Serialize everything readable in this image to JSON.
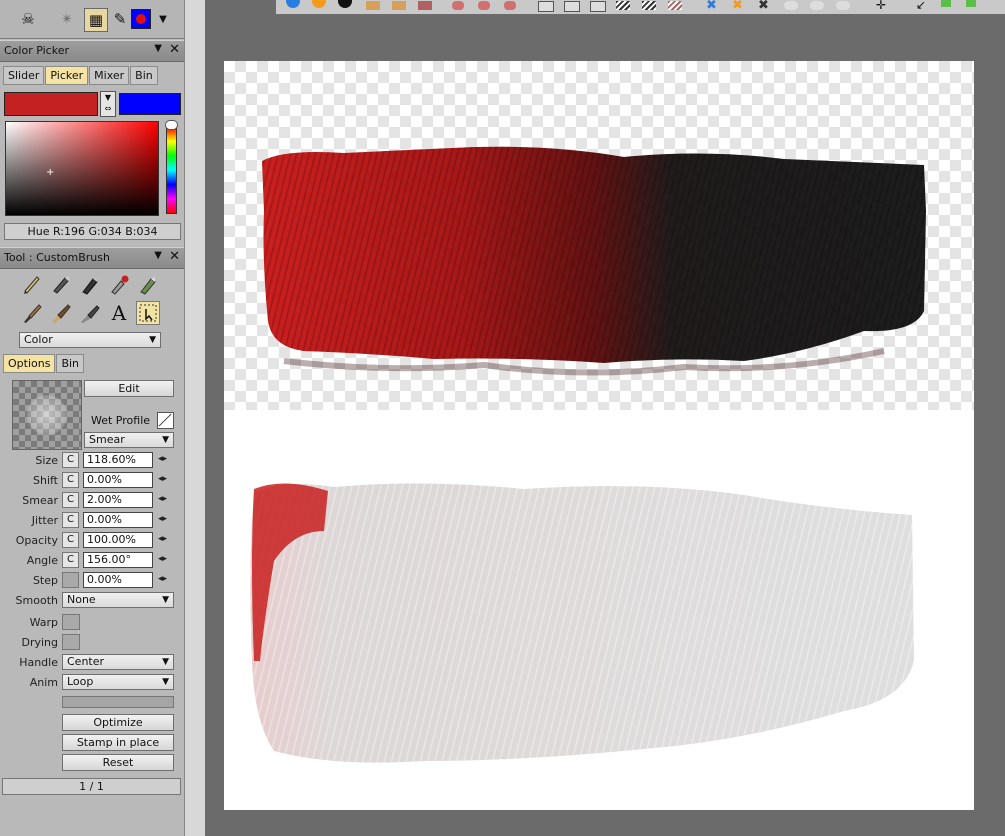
{
  "color_picker": {
    "title": "Color Picker",
    "tabs": [
      "Slider",
      "Picker",
      "Mixer",
      "Bin"
    ],
    "active_tab": "Picker",
    "primary_color": "#c42222",
    "secondary_color": "#0000ff",
    "readout": "Hue R:196 G:034 B:034"
  },
  "tool": {
    "title": "Tool : CustomBrush",
    "mode_select": "Color",
    "tabs": [
      "Options",
      "Bin"
    ],
    "active_tab": "Options",
    "edit_label": "Edit",
    "wet_profile_label": "Wet Profile",
    "brush_mode": "Smear",
    "params": [
      {
        "label": "Size",
        "value": "118.60%"
      },
      {
        "label": "Shift",
        "value": "0.00%"
      },
      {
        "label": "Smear",
        "value": "2.00%"
      },
      {
        "label": "Jitter",
        "value": "0.00%"
      },
      {
        "label": "Opacity",
        "value": "100.00%"
      },
      {
        "label": "Angle",
        "value": "156.00°"
      },
      {
        "label": "Step",
        "value": "0.00%"
      }
    ],
    "c_label": "C",
    "smooth_label": "Smooth",
    "smooth_value": "None",
    "warp_label": "Warp",
    "drying_label": "Drying",
    "handle_label": "Handle",
    "handle_value": "Center",
    "anim_label": "Anim",
    "anim_value": "Loop",
    "optimize_label": "Optimize",
    "stamp_label": "Stamp in place",
    "reset_label": "Reset",
    "page_counter": "1 / 1"
  },
  "colors": {
    "accent_tab": "#f5e3a2",
    "stroke_red": "#b01010",
    "stroke_black": "#111111",
    "smear_gray": "#d4d4d4"
  }
}
